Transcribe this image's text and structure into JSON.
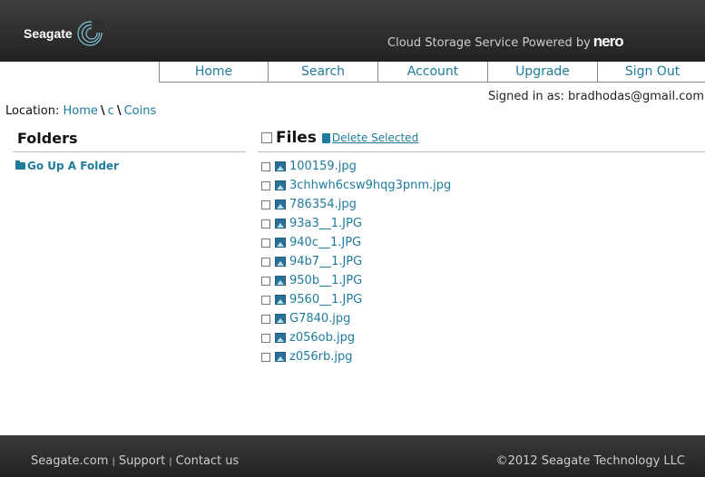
{
  "header": {
    "logo_text": "Seagate",
    "service_text": "Cloud Storage Service  Powered by",
    "brand": "nero"
  },
  "nav": [
    "Home",
    "Search",
    "Account",
    "Upgrade",
    "Sign Out"
  ],
  "location": {
    "label": "Location:",
    "crumbs": [
      "Home",
      "c",
      "Coins"
    ],
    "separator": "\\"
  },
  "signed_in": "Signed in as: bradhodas@gmail.com",
  "folders": {
    "title": "Folders",
    "go_up": "Go Up A Folder"
  },
  "files": {
    "title": "Files",
    "delete_selected": "Delete Selected",
    "items": [
      "100159.jpg",
      "3chhwh6csw9hqg3pnm.jpg",
      "786354.jpg",
      "93a3__1.JPG",
      "940c__1.JPG",
      "94b7__1.JPG",
      "950b__1.JPG",
      "9560__1.JPG",
      "G7840.jpg",
      "z056ob.jpg",
      "z056rb.jpg"
    ]
  },
  "footer": {
    "links": [
      "Seagate.com",
      "Support",
      "Contact us"
    ],
    "copyright": "©2012 Seagate Technology LLC"
  },
  "colors": {
    "link": "#1f7b9b",
    "bar": "#2b2b2b"
  }
}
